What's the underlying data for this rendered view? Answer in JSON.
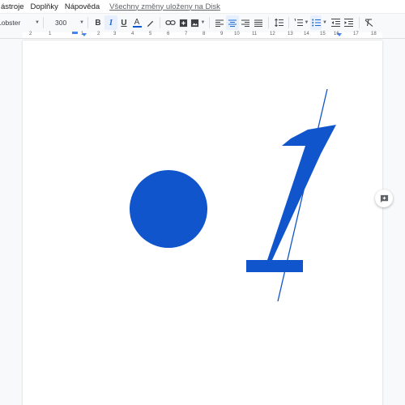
{
  "menu": {
    "items": [
      "ástroje",
      "Doplňky",
      "Nápověda"
    ],
    "save_status": "Všechny změny uloženy na Disk"
  },
  "toolbar": {
    "font_name": "Lobster",
    "font_size": "300",
    "bold": "B",
    "italic": "I",
    "underline": "U",
    "text_color_letter": "A"
  },
  "ruler": {
    "labels": [
      "2",
      "1",
      "1",
      "2",
      "3",
      "4",
      "5",
      "6",
      "7",
      "8",
      "9",
      "10",
      "11",
      "12",
      "13",
      "14",
      "15",
      "16",
      "17",
      "18"
    ]
  },
  "document": {
    "bullet_glyph": "●",
    "numeral": "1"
  },
  "colors": {
    "accent": "#1155cc",
    "text_color": "#1155cc",
    "toolbar_active": "#e8f0fe",
    "ruler_marker": "#4285f4"
  },
  "icons": {
    "comment": "add-comment-icon",
    "link": "link-icon",
    "image": "image-icon",
    "highlighter": "highlighter-icon",
    "clear_format": "clear-formatting-icon"
  }
}
